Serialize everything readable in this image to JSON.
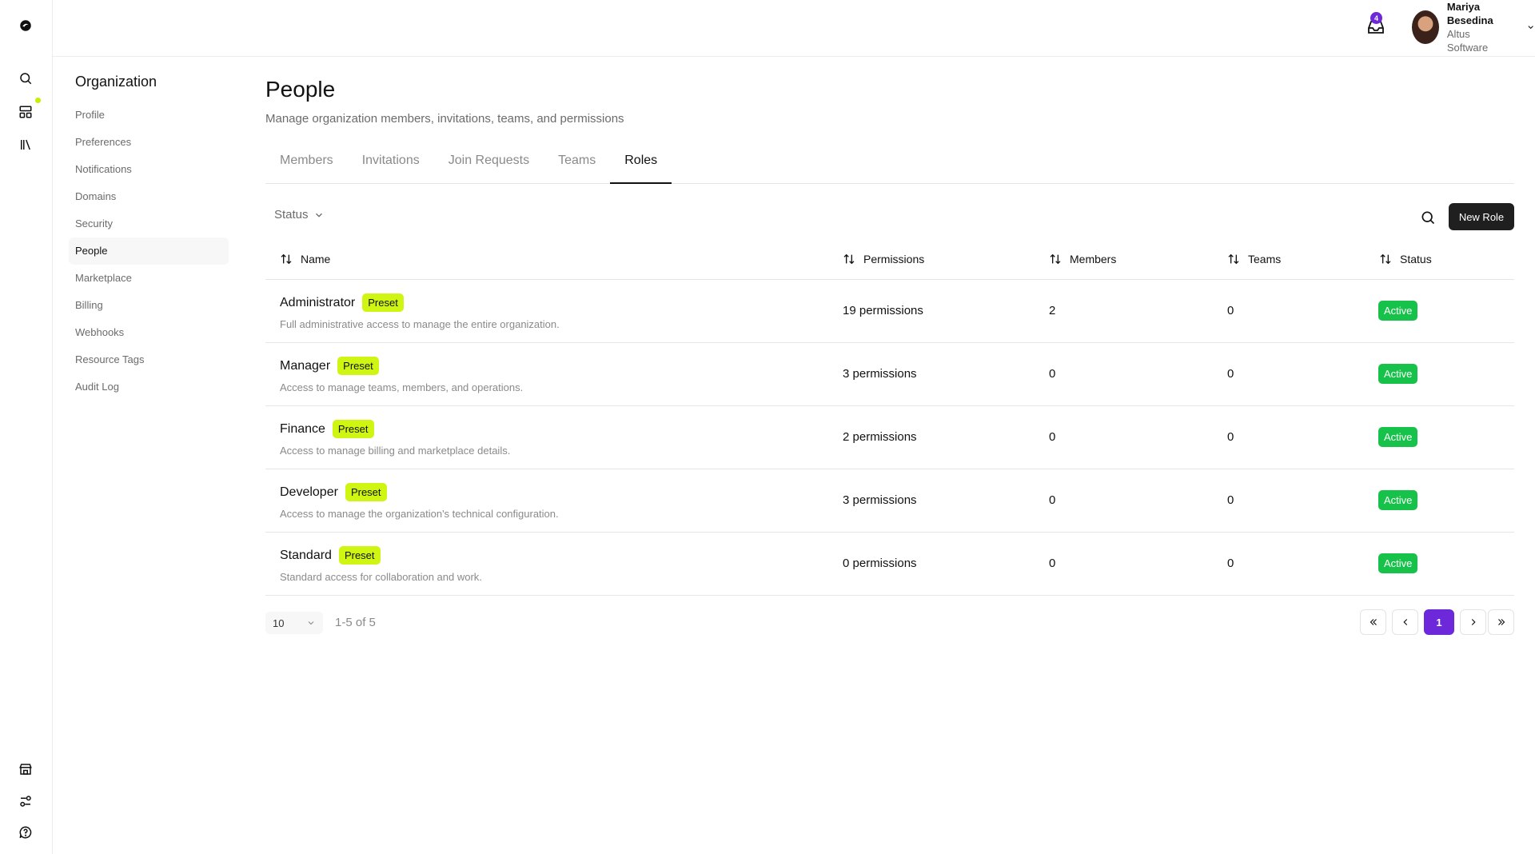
{
  "rail": {
    "icons": [
      "logo-icon",
      "search-icon",
      "dashboard-icon",
      "library-icon",
      "store-icon",
      "filters-icon",
      "help-icon"
    ]
  },
  "header": {
    "notification_count": "4",
    "user_name": "Mariya Besedina",
    "user_org": "Altus Software"
  },
  "sidebar": {
    "heading": "Organization",
    "items": [
      {
        "label": "Profile"
      },
      {
        "label": "Preferences"
      },
      {
        "label": "Notifications"
      },
      {
        "label": "Domains"
      },
      {
        "label": "Security"
      },
      {
        "label": "People"
      },
      {
        "label": "Marketplace"
      },
      {
        "label": "Billing"
      },
      {
        "label": "Webhooks"
      },
      {
        "label": "Resource Tags"
      },
      {
        "label": "Audit Log"
      }
    ],
    "active_index": 5
  },
  "page": {
    "title": "People",
    "subtitle": "Manage organization members, invitations, teams, and permissions"
  },
  "tabs": [
    {
      "label": "Members"
    },
    {
      "label": "Invitations"
    },
    {
      "label": "Join Requests"
    },
    {
      "label": "Teams"
    },
    {
      "label": "Roles"
    }
  ],
  "active_tab": "Roles",
  "toolbar": {
    "status_filter": "Status",
    "new_role_label": "New Role"
  },
  "table": {
    "columns": [
      {
        "label": "Name"
      },
      {
        "label": "Permissions"
      },
      {
        "label": "Members"
      },
      {
        "label": "Teams"
      },
      {
        "label": "Status"
      }
    ],
    "rows": [
      {
        "name": "Administrator",
        "tag": "Preset",
        "description": "Full administrative access to manage the entire organization.",
        "permissions": "19 permissions",
        "members": "2",
        "teams": "0",
        "status": "Active"
      },
      {
        "name": "Manager",
        "tag": "Preset",
        "description": "Access to manage teams, members, and operations.",
        "permissions": "3 permissions",
        "members": "0",
        "teams": "0",
        "status": "Active"
      },
      {
        "name": "Finance",
        "tag": "Preset",
        "description": "Access to manage billing and marketplace details.",
        "permissions": "2 permissions",
        "members": "0",
        "teams": "0",
        "status": "Active"
      },
      {
        "name": "Developer",
        "tag": "Preset",
        "description": "Access to manage the organization's technical configuration.",
        "permissions": "3 permissions",
        "members": "0",
        "teams": "0",
        "status": "Active"
      },
      {
        "name": "Standard",
        "tag": "Preset",
        "description": "Standard access for collaboration and work.",
        "permissions": "0 permissions",
        "members": "0",
        "teams": "0",
        "status": "Active"
      }
    ]
  },
  "pagination": {
    "page_size": "10",
    "range": "1-5 of 5",
    "current_page": "1"
  },
  "colors": {
    "preset_tag": "#cff512",
    "active_badge": "#17c24a",
    "accent": "#6d28d9",
    "primary_button": "#1f1f1f"
  }
}
